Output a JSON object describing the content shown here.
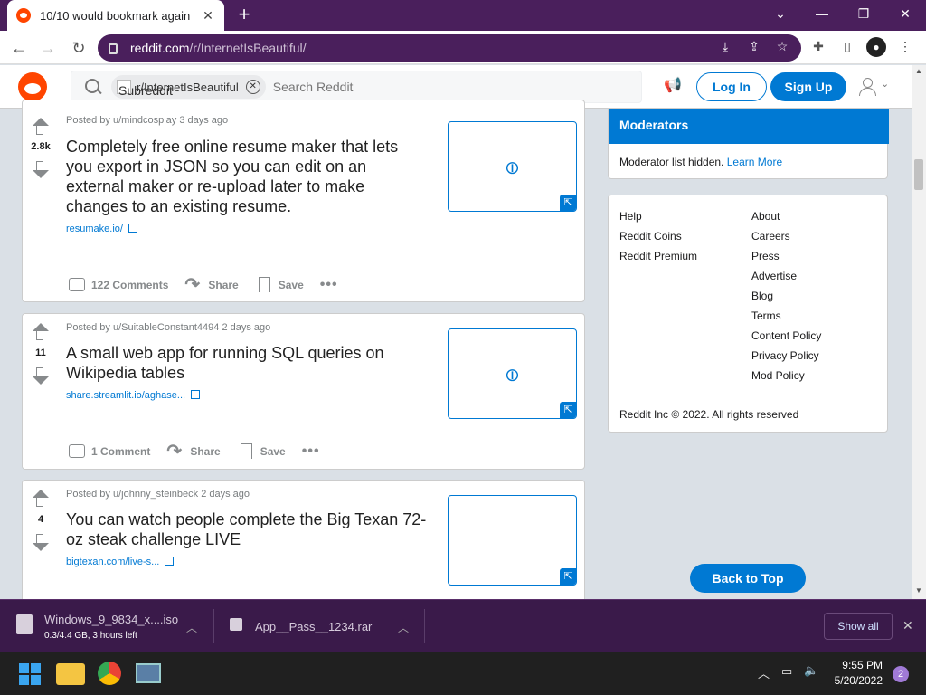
{
  "browser": {
    "tab_title": "10/10 would bookmark again",
    "tab_close": "✕",
    "new_tab": "+",
    "url_domain": "reddit.com",
    "url_path": "/r/InternetIsBeautiful/"
  },
  "header": {
    "subreddit_chip": "r/InternetIsBeautiful",
    "subreddit_icon_alt": "Subreddit Icon",
    "search_placeholder": "Search Reddit",
    "login_label": "Log In",
    "signup_label": "Sign Up"
  },
  "posts": [
    {
      "score": "2.8k",
      "meta": "Posted by u/mindcosplay 3 days ago",
      "title": "Completely free online resume maker that lets you export in JSON so you can edit on an external maker or re-upload later to make changes to an existing resume.",
      "link": "resumake.io/",
      "comments": "122 Comments",
      "share": "Share",
      "save": "Save"
    },
    {
      "score": "11",
      "meta": "Posted by u/SuitableConstant4494 2 days ago",
      "title": "A small web app for running SQL queries on Wikipedia tables",
      "link": "share.streamlit.io/aghase...",
      "comments": "1 Comment",
      "share": "Share",
      "save": "Save"
    },
    {
      "score": "4",
      "meta": "Posted by u/johnny_steinbeck 2 days ago",
      "title": "You can watch people complete the Big Texan 72-oz steak challenge LIVE",
      "link": "bigtexan.com/live-s..."
    }
  ],
  "sidebar": {
    "moderators_title": "Moderators",
    "moderators_text": "Moderator list hidden.",
    "learn_more": "Learn More",
    "links_left": [
      "Help",
      "Reddit Coins",
      "Reddit Premium"
    ],
    "links_right": [
      "About",
      "Careers",
      "Press",
      "Advertise",
      "Blog",
      "Terms",
      "Content Policy",
      "Privacy Policy",
      "Mod Policy"
    ],
    "copyright": "Reddit Inc © 2022. All rights reserved",
    "back_to_top": "Back to Top"
  },
  "downloads": {
    "items": [
      {
        "name": "Windows_9_9834_x....iso",
        "status": "0.3/4.4 GB, 3 hours left"
      },
      {
        "name": "App__Pass__1234.rar",
        "status": ""
      }
    ],
    "show_all": "Show all"
  },
  "taskbar": {
    "time": "9:55 PM",
    "date": "5/20/2022",
    "notifications": "2"
  }
}
